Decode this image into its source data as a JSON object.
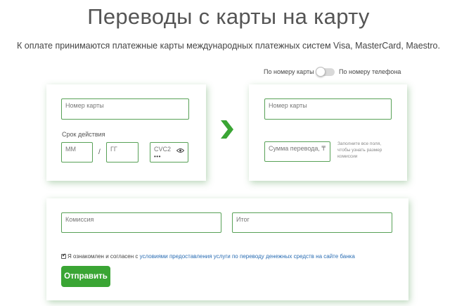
{
  "header": {
    "title": "Переводы с карты на карту",
    "subtitle": "К оплате принимаются платежные карты международных платежных систем Visa, MasterCard, Maestro."
  },
  "toggle": {
    "left_label": "По номеру карты",
    "right_label": "По номеру телефона",
    "selected": "По номеру карты"
  },
  "sender_card": {
    "card_number_label": "Номер карты",
    "expiry_label": "Срок действия",
    "month_placeholder": "ММ",
    "separator": "/",
    "year_placeholder": "ГГ",
    "cvc_label": "CVC2",
    "cvc_mask": "•••"
  },
  "recipient_card": {
    "card_number_label": "Номер карты",
    "amount_label": "Сумма перевода, ₸",
    "hint": "Заполните все поля, чтобы узнать размер комиссии"
  },
  "summary": {
    "commission_label": "Комиссия",
    "total_label": "Итог",
    "consent_prefix": "Я ознакомлен и согласен с",
    "consent_link": "условиями предоставления услуги по переводу денежных средств на сайте банка",
    "consent_checked": true,
    "submit_label": "Отправить"
  },
  "colors": {
    "accent": "#3aa534",
    "field_border": "#58a157",
    "link": "#2a6db3"
  }
}
